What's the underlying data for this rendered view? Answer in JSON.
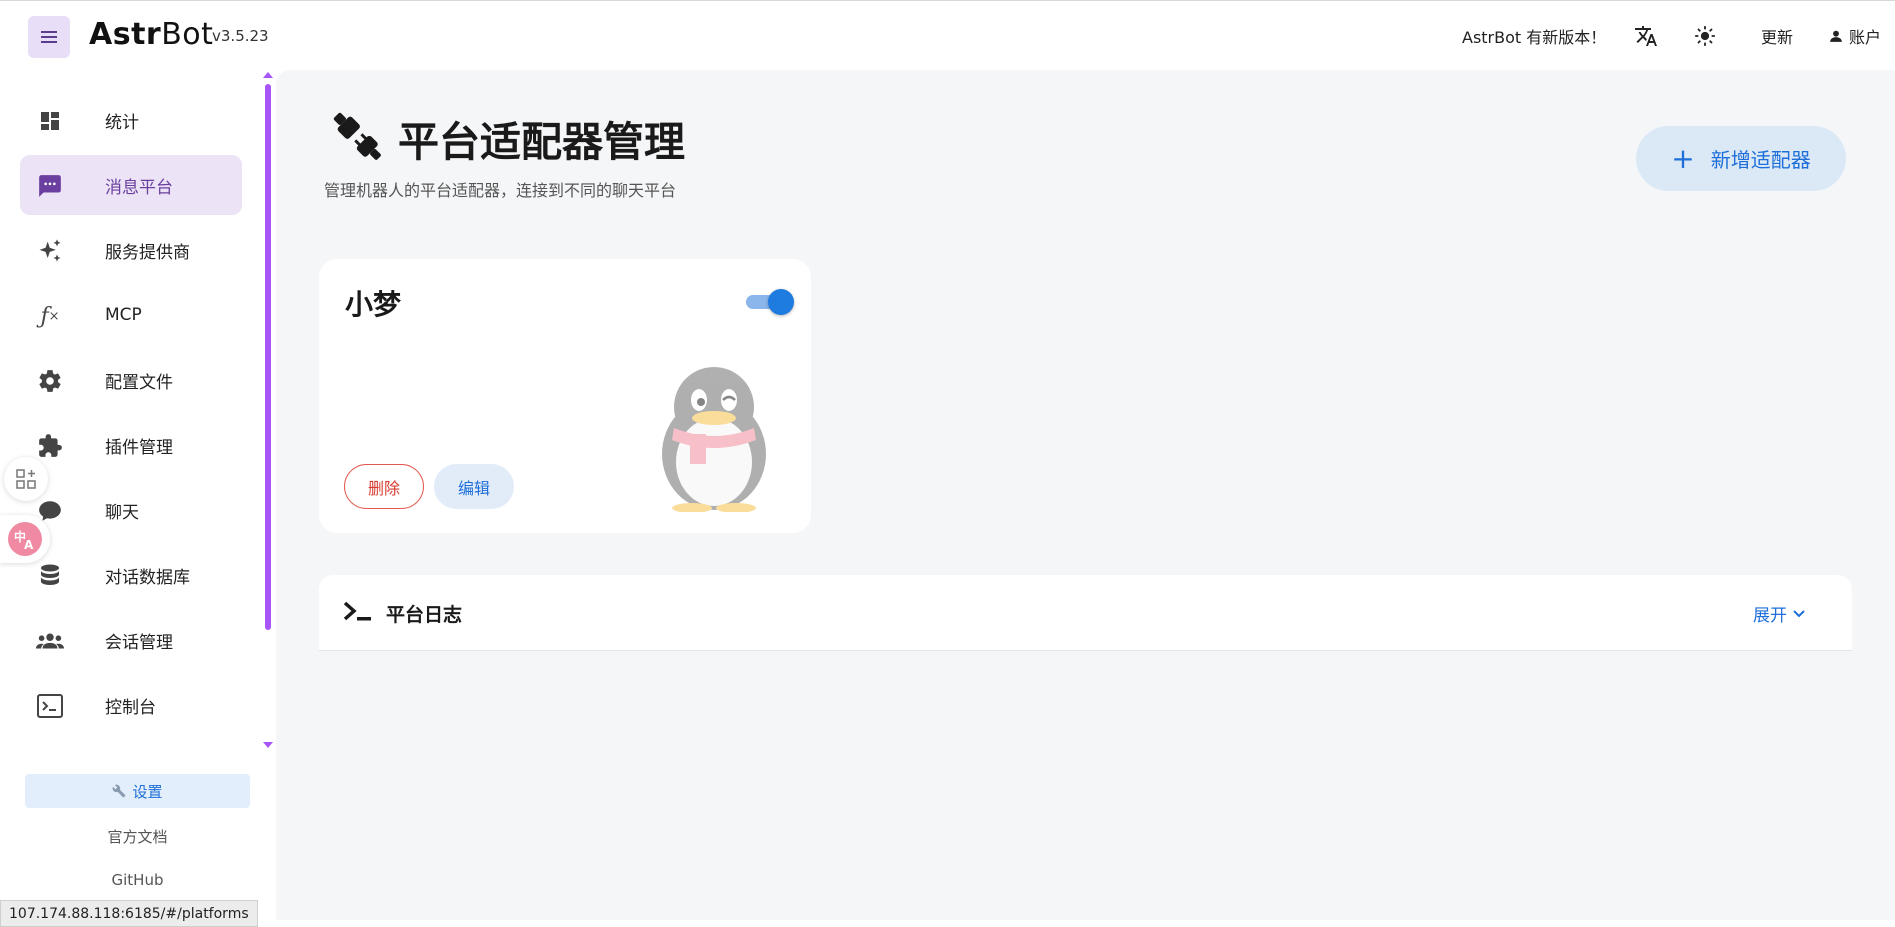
{
  "app": {
    "brand_strong": "Astr",
    "brand_rest": "Bot",
    "version": "v3.5.23"
  },
  "topbar": {
    "new_version_notice": "AstrBot 有新版本！",
    "update_label": "更新",
    "account_label": "账户"
  },
  "sidebar": {
    "items": [
      {
        "label": "统计",
        "icon": "dashboard-icon"
      },
      {
        "label": "消息平台",
        "icon": "message-icon",
        "active": true
      },
      {
        "label": "服务提供商",
        "icon": "sparkle-icon"
      },
      {
        "label": "MCP",
        "icon": "function-icon"
      },
      {
        "label": "配置文件",
        "icon": "gear-icon"
      },
      {
        "label": "插件管理",
        "icon": "puzzle-icon"
      },
      {
        "label": "聊天",
        "icon": "chat-bubble-icon"
      },
      {
        "label": "对话数据库",
        "icon": "database-icon"
      },
      {
        "label": "会话管理",
        "icon": "users-icon"
      },
      {
        "label": "控制台",
        "icon": "console-icon"
      }
    ],
    "settings_label": "设置",
    "docs_label": "官方文档",
    "github_label": "GitHub"
  },
  "status_url": "107.174.88.118:6185/#/platforms",
  "page": {
    "title": "平台适配器管理",
    "subtitle": "管理机器人的平台适配器，连接到不同的聊天平台",
    "add_button": "新增适配器"
  },
  "adapters": [
    {
      "name": "小梦",
      "enabled": true,
      "platform_icon": "qq-penguin-icon",
      "delete_label": "删除",
      "edit_label": "编辑"
    }
  ],
  "log_panel": {
    "title": "平台日志",
    "expand_label": "展开"
  },
  "colors": {
    "accent": "#1e6fd9",
    "active_nav_bg": "#ece4f6",
    "active_nav_text": "#6b3fa0",
    "scrollbar": "#a855f7",
    "delete": "#d93a2f"
  }
}
